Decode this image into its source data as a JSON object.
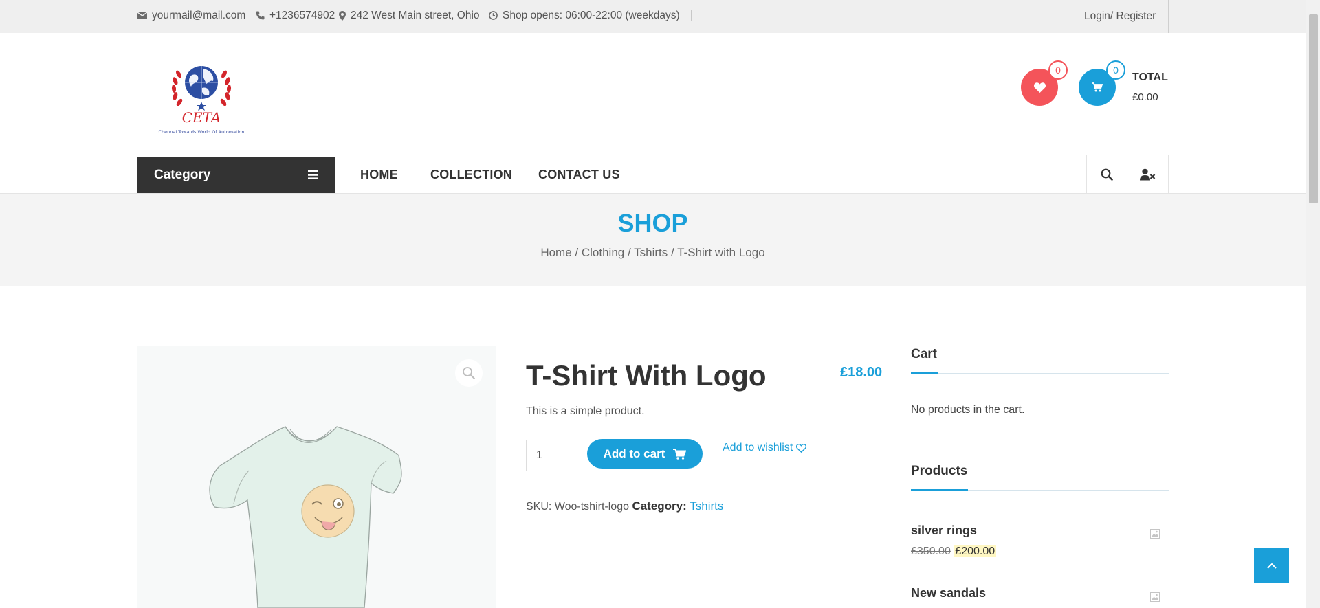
{
  "topbar": {
    "email": "yourmail@mail.com",
    "phone": "+1236574902",
    "address": "242 West Main street, Ohio",
    "hours": "Shop opens: 06:00-22:00 (weekdays)",
    "login": "Login/ Register"
  },
  "header": {
    "logo_title": "CETA",
    "logo_tagline": "Chennai Towards World Of Automation",
    "wishlist_count": "0",
    "cart_count": "0",
    "total_label": "TOTAL",
    "total_value": "£0.00"
  },
  "nav": {
    "category_label": "Category",
    "links": [
      "HOME",
      "COLLECTION",
      "CONTACT US"
    ]
  },
  "banner": {
    "title": "SHOP",
    "breadcrumb": [
      "Home",
      "Clothing",
      "Tshirts",
      "T-Shirt with Logo"
    ],
    "separator": " / "
  },
  "product": {
    "title": "T-Shirt With Logo",
    "price": "£18.00",
    "description": "This is a simple product.",
    "quantity": "1",
    "add_to_cart": "Add to cart",
    "add_to_wishlist": "Add to wishlist",
    "sku_label": "SKU:",
    "sku": "Woo-tshirt-logo",
    "category_label": "Category:",
    "category": "Tshirts"
  },
  "sidebar": {
    "cart_title": "Cart",
    "cart_empty": "No products in the cart.",
    "products_title": "Products",
    "products": [
      {
        "name": "silver rings",
        "old_price": "£350.00",
        "price": "£200.00"
      },
      {
        "name": "New sandals"
      }
    ]
  },
  "colors": {
    "accent": "#1a9fd9",
    "wishlist": "#f4545a",
    "dark": "#333333"
  }
}
